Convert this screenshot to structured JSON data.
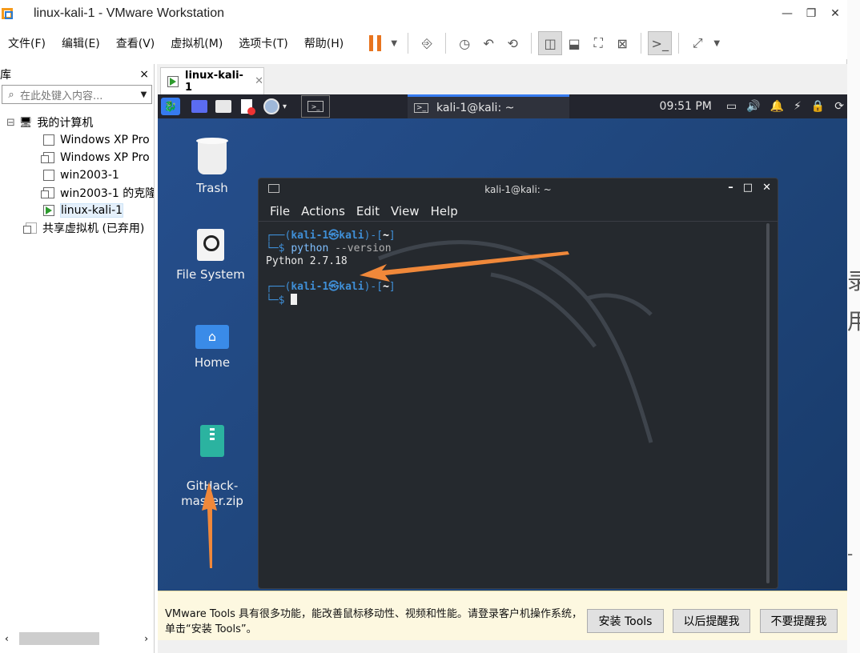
{
  "window": {
    "title": "linux-kali-1 - VMware Workstation"
  },
  "menubar": {
    "items": [
      "文件(F)",
      "编辑(E)",
      "查看(V)",
      "虚拟机(M)",
      "选项卡(T)",
      "帮助(H)"
    ]
  },
  "library": {
    "title": "库",
    "close": "×",
    "search_placeholder": "在此处键入内容...",
    "tree": {
      "root": "我的计算机",
      "vms": [
        "Windows XP Pro",
        "Windows XP Pro",
        "win2003-1",
        "win2003-1 的克隆",
        "linux-kali-1"
      ],
      "shared": "共享虚拟机 (已弃用)"
    },
    "collapse_glyph": "⊟"
  },
  "vm_tab": {
    "label": "linux-kali-1"
  },
  "kali_panel": {
    "task_window": "kali-1@kali: ~",
    "clock": "09:51 PM"
  },
  "desktop": {
    "icons": [
      "Trash",
      "File System",
      "Home",
      "GitHack-\nmaster.zip"
    ]
  },
  "terminal": {
    "title": "kali-1@kali: ~",
    "menu": [
      "File",
      "Actions",
      "Edit",
      "View",
      "Help"
    ],
    "lines": {
      "p1_open": "┌──(",
      "user": "kali-1㉿kali",
      "p1_close": ")-[",
      "dir": "~",
      "p1_end": "]",
      "p2": "└─$ ",
      "cmd": "python",
      "cmd_arg": " --version",
      "output": "Python 2.7.18"
    }
  },
  "notification": {
    "message": "VMware Tools 具有很多功能，能改善鼠标移动性、视频和性能。请登录客户机操作系统，单击“安装 Tools”。",
    "install": "安装 Tools",
    "later": "以后提醒我",
    "never": "不要提醒我"
  },
  "colors": {
    "accent_orange": "#f0883a",
    "kali_blue": "#367bf0",
    "desktop_bg": "#1e4478"
  }
}
